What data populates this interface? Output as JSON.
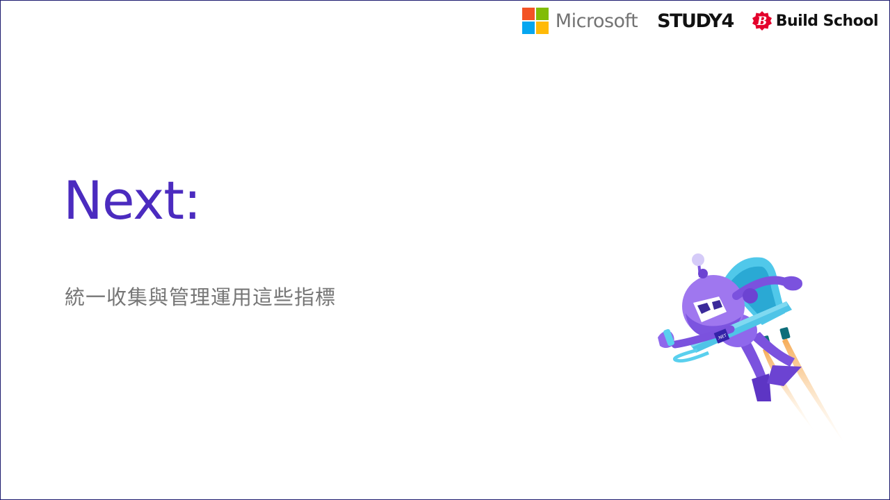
{
  "sponsors": {
    "microsoft": "Microsoft",
    "study4": "STUDY4",
    "build_school": "Build School",
    "build_school_mark": "B"
  },
  "slide": {
    "title": "Next:",
    "subtitle": "統一收集與管理運用這些指標"
  },
  "mascot": {
    "badge": ".NET"
  },
  "colors": {
    "title": "#4b2bbf",
    "subtitle": "#767676",
    "border": "#1c1a6e",
    "ms_red": "#f35325",
    "ms_green": "#81bc06",
    "ms_blue": "#05a6f0",
    "ms_yellow": "#ffba08",
    "build_school_red": "#e4002b"
  }
}
